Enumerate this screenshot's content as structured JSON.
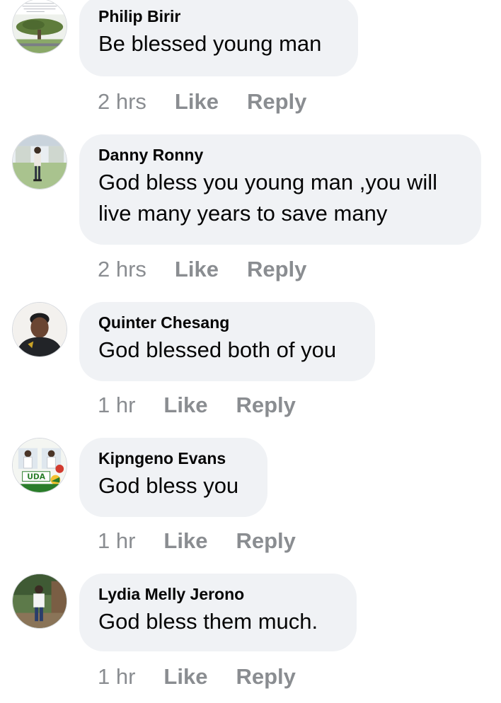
{
  "comments": [
    {
      "author": "Philip Birir",
      "text": "Be blessed young man",
      "time": "2 hrs",
      "like": "Like",
      "reply": "Reply"
    },
    {
      "author": "Danny Ronny",
      "text": "God bless you young man ,you will live many years to save many",
      "time": "2 hrs",
      "like": "Like",
      "reply": "Reply"
    },
    {
      "author": "Quinter Chesang",
      "text": "God blessed both of you",
      "time": "1 hr",
      "like": "Like",
      "reply": "Reply"
    },
    {
      "author": "Kipngeno Evans",
      "text": "God bless you",
      "time": "1 hr",
      "like": "Like",
      "reply": "Reply"
    },
    {
      "author": "Lydia Melly Jerono",
      "text": "God bless them much.",
      "time": "1 hr",
      "like": "Like",
      "reply": "Reply"
    }
  ],
  "avatar_badge_text": "UDA",
  "colors": {
    "bubble_bg": "#f0f2f5",
    "text": "#050505",
    "meta": "#8a8d91"
  }
}
